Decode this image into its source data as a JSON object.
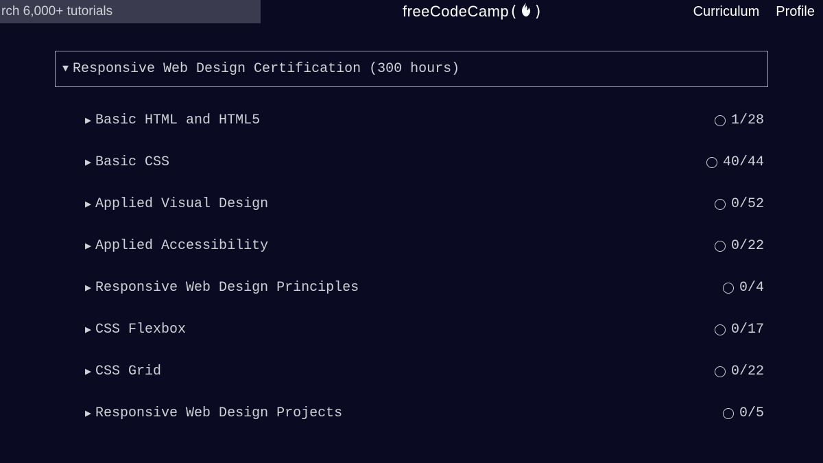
{
  "header": {
    "search_value": "rch 6,000+ tutorials",
    "brand_text": "freeCodeCamp",
    "nav": {
      "curriculum": "Curriculum",
      "profile": "Profile"
    }
  },
  "certification": {
    "title": "Responsive Web Design Certification (300 hours)",
    "modules": [
      {
        "name": "Basic HTML and HTML5",
        "progress": "1/28"
      },
      {
        "name": "Basic CSS",
        "progress": "40/44"
      },
      {
        "name": "Applied Visual Design",
        "progress": "0/52"
      },
      {
        "name": "Applied Accessibility",
        "progress": "0/22"
      },
      {
        "name": "Responsive Web Design Principles",
        "progress": "0/4"
      },
      {
        "name": "CSS Flexbox",
        "progress": "0/17"
      },
      {
        "name": "CSS Grid",
        "progress": "0/22"
      },
      {
        "name": "Responsive Web Design Projects",
        "progress": "0/5"
      }
    ]
  }
}
